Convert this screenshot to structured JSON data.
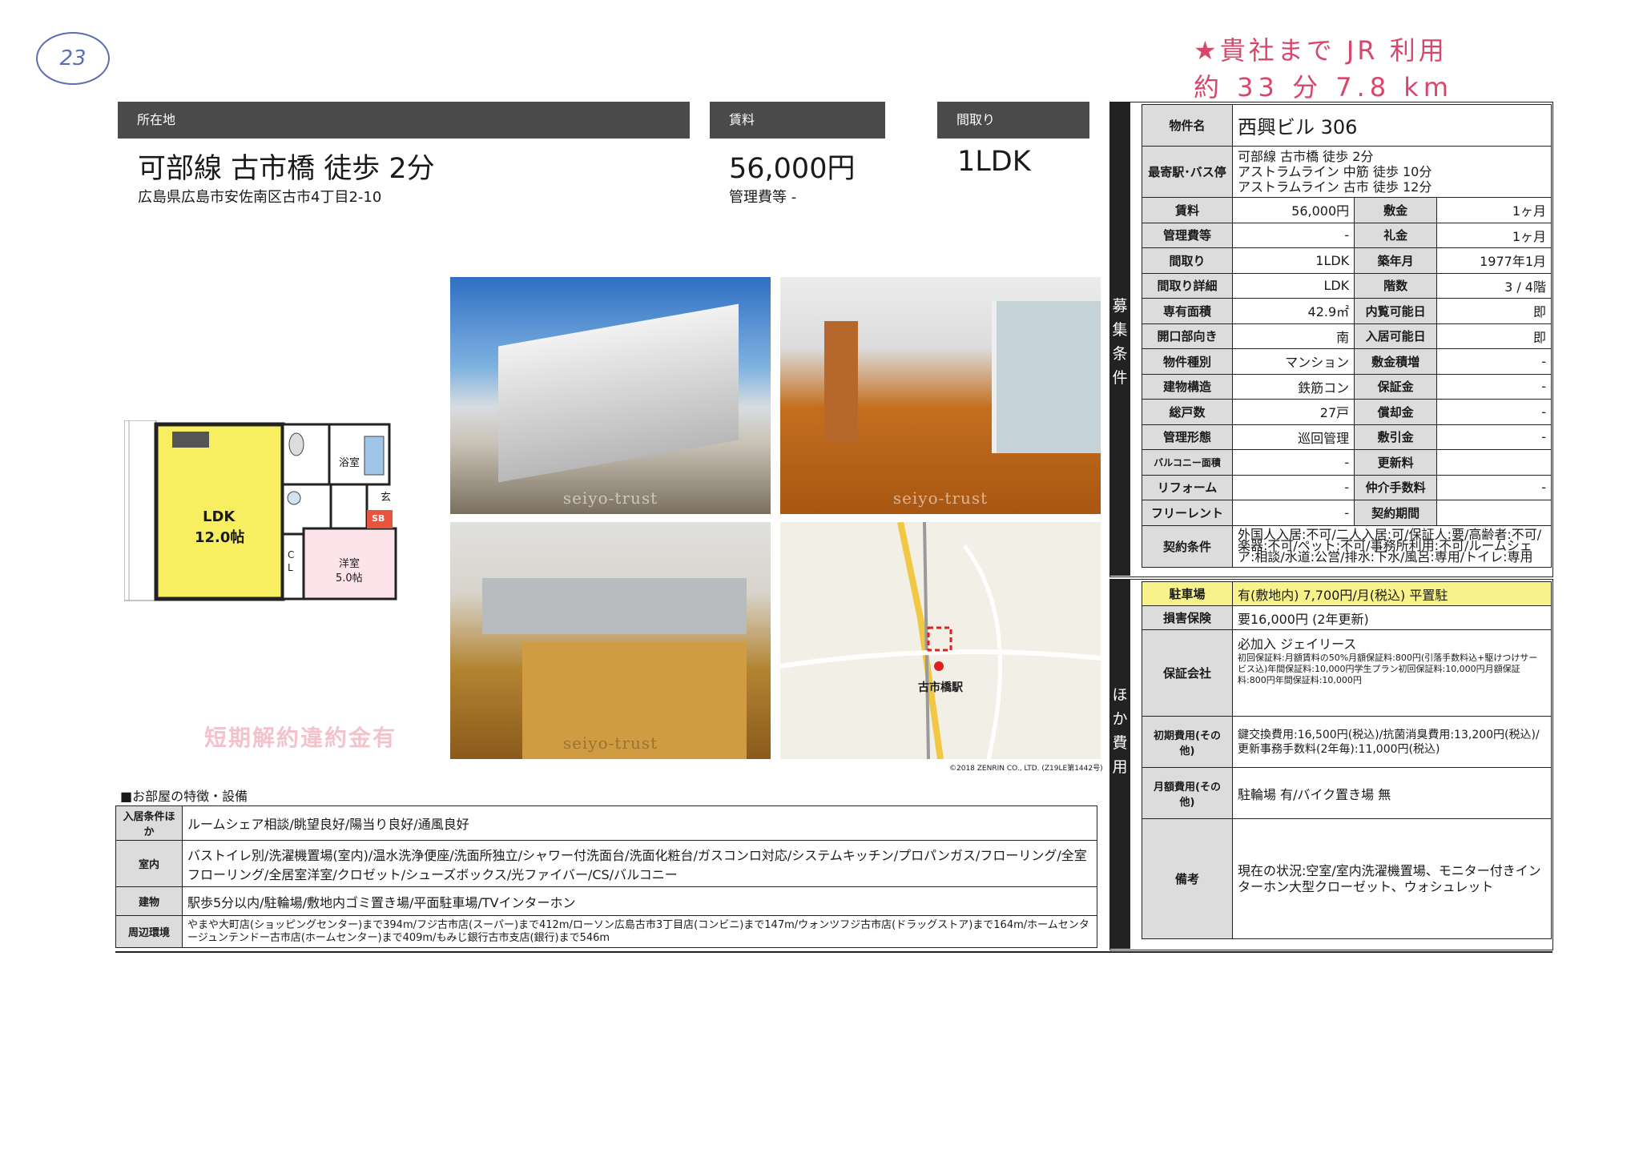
{
  "corner_note": "23",
  "handwritten": {
    "line1": "★貴社まで JR 利用",
    "line2": "約 33 分 7.8 km"
  },
  "header": {
    "location_label": "所在地",
    "rent_label": "賃料",
    "layout_label": "間取り"
  },
  "summary": {
    "access": "可部線 古市橋 徒歩 2分",
    "address": "広島県広島市安佐南区古市4丁目2-10",
    "rent": "56,000円",
    "management_fee": "管理費等 -",
    "layout": "1LDK"
  },
  "floorplan": {
    "ldk": "LDK",
    "ldk_size": "12.0帖",
    "bath": "浴室",
    "entrance": "玄",
    "sb": "SB",
    "cl": "C L",
    "western": "洋室",
    "western_size": "5.0帖"
  },
  "penalty_notice": "短期解約違約金有",
  "watermark": "seiyo-trust",
  "map": {
    "station": "古市橋駅",
    "copyright": "©2018 ZENRIN CO., LTD. (Z19LE第1442号)"
  },
  "side_labels": {
    "recruit": "募集条件",
    "other_costs": "ほか費用"
  },
  "spec": {
    "property_name_label": "物件名",
    "property_name": "西興ビル 306",
    "station_label": "最寄駅･バス停",
    "stations": [
      "可部線 古市橋 徒歩 2分",
      "アストラムライン 中筋 徒歩 10分",
      "アストラムライン 古市 徒歩 12分"
    ],
    "rows": [
      {
        "l1": "賃料",
        "v1": "56,000円",
        "l2": "敷金",
        "v2": "1ヶ月"
      },
      {
        "l1": "管理費等",
        "v1": "-",
        "l2": "礼金",
        "v2": "1ヶ月"
      },
      {
        "l1": "間取り",
        "v1": "1LDK",
        "l2": "築年月",
        "v2": "1977年1月"
      },
      {
        "l1": "間取り詳細",
        "v1": "LDK",
        "l2": "階数",
        "v2": "3 / 4階"
      },
      {
        "l1": "専有面積",
        "v1": "42.9㎡",
        "l2": "内覧可能日",
        "v2": "即"
      },
      {
        "l1": "開口部向き",
        "v1": "南",
        "l2": "入居可能日",
        "v2": "即"
      },
      {
        "l1": "物件種別",
        "v1": "マンション",
        "l2": "敷金積増",
        "v2": "-"
      },
      {
        "l1": "建物構造",
        "v1": "鉄筋コン",
        "l2": "保証金",
        "v2": "-"
      },
      {
        "l1": "総戸数",
        "v1": "27戸",
        "l2": "償却金",
        "v2": "-"
      },
      {
        "l1": "管理形態",
        "v1": "巡回管理",
        "l2": "敷引金",
        "v2": "-"
      },
      {
        "l1": "バルコニー面積",
        "v1": "-",
        "l2": "更新料",
        "v2": ""
      },
      {
        "l1": "リフォーム",
        "v1": "-",
        "l2": "仲介手数料",
        "v2": "-"
      },
      {
        "l1": "フリーレント",
        "v1": "-",
        "l2": "契約期間",
        "v2": ""
      }
    ],
    "contract_label": "契約条件",
    "contract": "外国人入居:不可/二人入居:可/保証人:要/高齢者:不可/楽器:不可/ペット:不可/事務所利用:不可/ルームシェア:相談/水道:公営/排水:下水/風呂:専用/トイレ:専用"
  },
  "other": {
    "parking_label": "駐車場",
    "parking": "有(敷地内) 7,700円/月(税込) 平置駐",
    "insurance_label": "損害保険",
    "insurance": "要16,000円 (2年更新)",
    "guarantor_label": "保証会社",
    "guarantor_main": "必加入 ジェイリース",
    "guarantor_detail": "初回保証料:月額賃料の50%月額保証料:800円(引落手数料込+駆けつけサービス込)年間保証料:10,000円学生プラン初回保証料:10,000円月額保証料:800円年間保証料:10,000円",
    "initial_label": "初期費用(その他)",
    "initial": "鍵交換費用:16,500円(税込)/抗菌消臭費用:13,200円(税込)/更新事務手数料(2年毎):11,000円(税込)",
    "monthly_label": "月額費用(その他)",
    "monthly": "駐輪場 有/バイク置き場 無",
    "remarks_label": "備考",
    "remarks": "現在の状況:空室/室内洗濯機置場、モニター付きインターホン大型クローゼット、ウォシュレット"
  },
  "features": {
    "title": "■お部屋の特徴・設備",
    "rows": [
      {
        "label": "入居条件ほか",
        "value": "ルームシェア相談/眺望良好/陽当り良好/通風良好"
      },
      {
        "label": "室内",
        "value": "バストイレ別/洗濯機置場(室内)/温水洗浄便座/洗面所独立/シャワー付洗面台/洗面化粧台/ガスコンロ対応/システムキッチン/プロパンガス/フローリング/全室フローリング/全居室洋室/クロゼット/シューズボックス/光ファイバー/CS/バルコニー"
      },
      {
        "label": "建物",
        "value": "駅歩5分以内/駐輪場/敷地内ゴミ置き場/平面駐車場/TVインターホン"
      },
      {
        "label": "周辺環境",
        "value": "やまや大町店(ショッピングセンター)まで394m/フジ古市店(スーパー)まで412m/ローソン広島古市3丁目店(コンビニ)まで147m/ウォンツフジ古市店(ドラッグストア)まで164m/ホームセンタージュンテンドー古市店(ホームセンター)まで409m/もみじ銀行古市支店(銀行)まで546m"
      }
    ]
  }
}
